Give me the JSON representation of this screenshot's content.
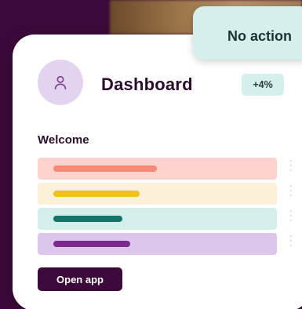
{
  "dashboard": {
    "title": "Dashboard",
    "change_badge": "+4%",
    "section_label": "Welcome",
    "rows": [
      {
        "color": "#f58b74",
        "background": "#ffd3cd"
      },
      {
        "color": "#f1c21b",
        "background": "#fdf0d9"
      },
      {
        "color": "#117568",
        "background": "#d3eeeb"
      },
      {
        "color": "#7c2a8b",
        "background": "#dcc6ec"
      }
    ],
    "open_button_label": "Open app",
    "avatar_icon": "user-icon"
  },
  "toast": {
    "label": "No action"
  },
  "colors": {
    "brand": "#3b0a3a",
    "accent_teal": "#d4efec",
    "avatar_bg": "#e2d3ee"
  }
}
